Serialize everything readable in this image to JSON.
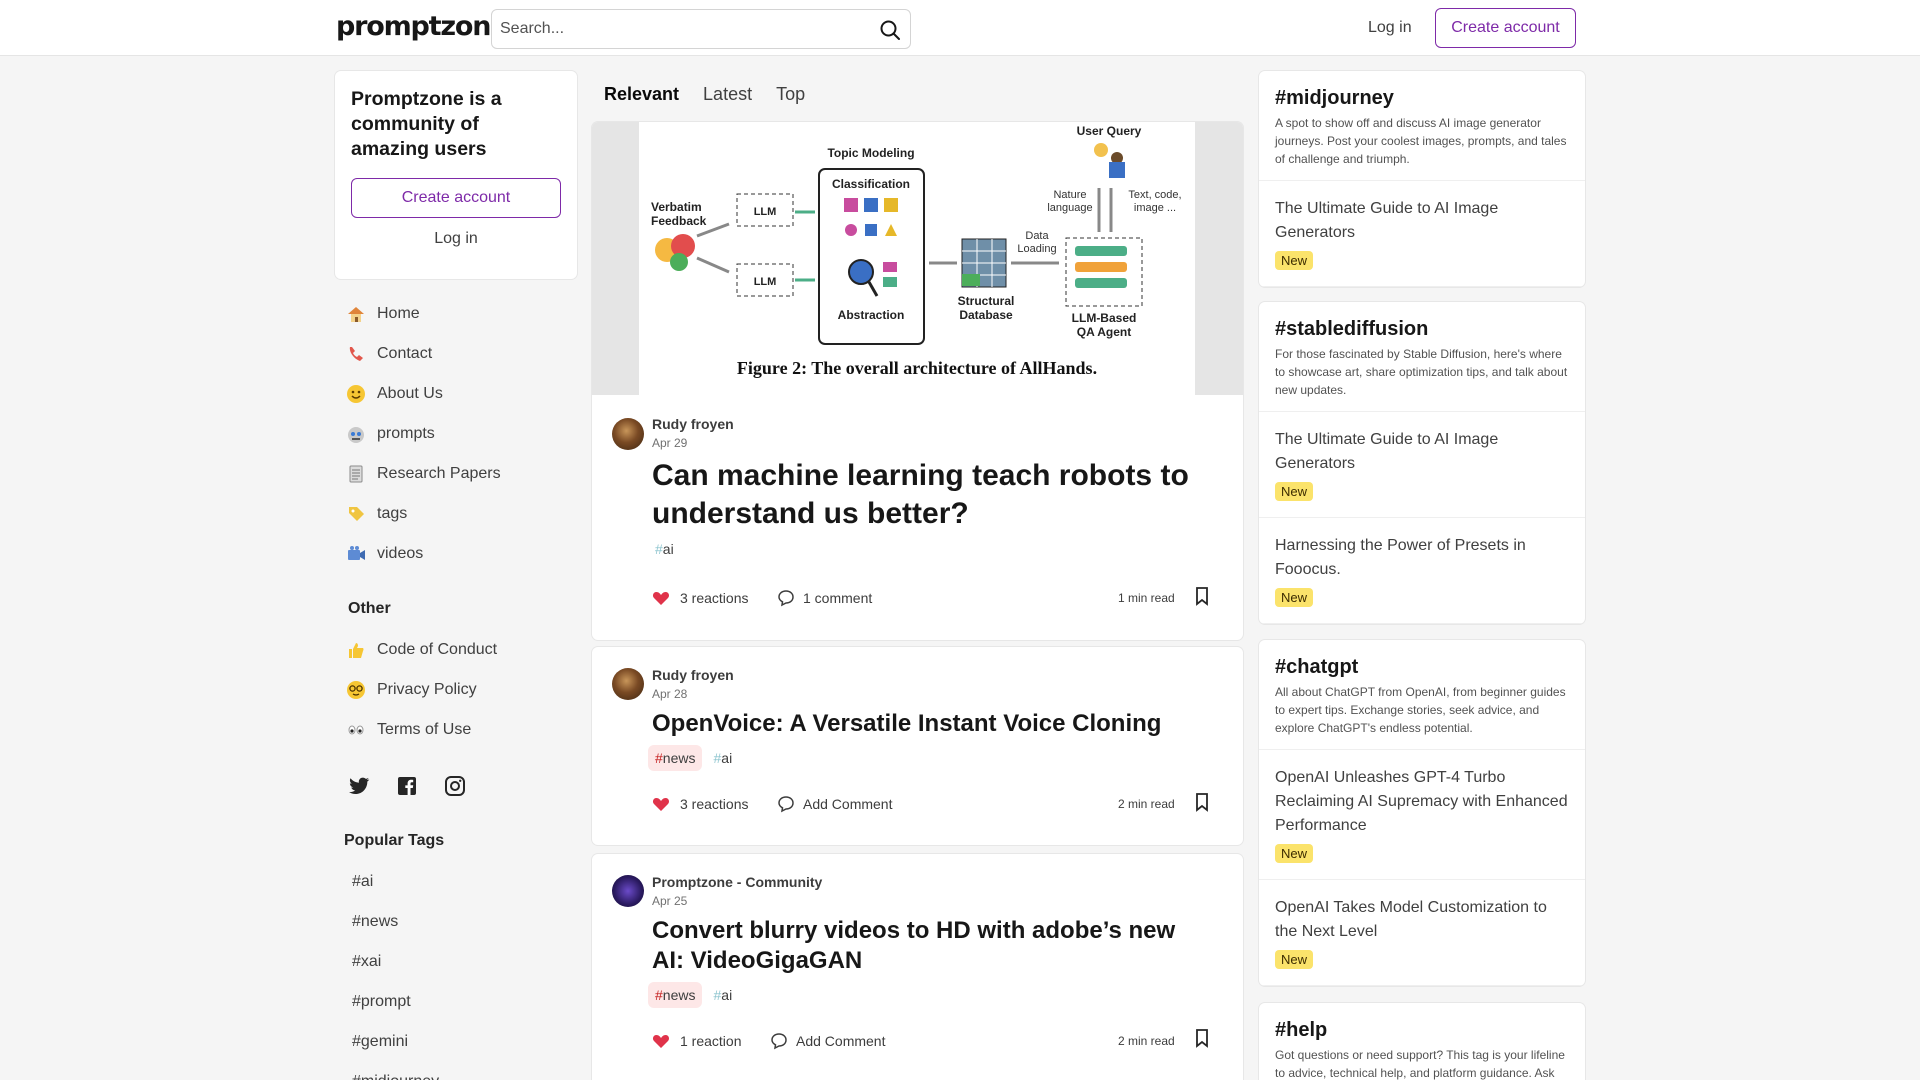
{
  "header": {
    "logo": "promptzone.",
    "search_placeholder": "Search...",
    "login": "Log in",
    "create_account": "Create account"
  },
  "promo": {
    "title": "Promptzone is a community of amazing users",
    "create_account": "Create account",
    "login": "Log in"
  },
  "nav": {
    "items": [
      {
        "label": "Home",
        "icon": "house-icon"
      },
      {
        "label": "Contact",
        "icon": "telephone-icon"
      },
      {
        "label": "About Us",
        "icon": "smiley-icon"
      },
      {
        "label": "prompts",
        "icon": "robot-face-icon"
      },
      {
        "label": "Research Papers",
        "icon": "document-icon"
      },
      {
        "label": "tags",
        "icon": "label-tag-icon"
      },
      {
        "label": "videos",
        "icon": "video-camera-icon"
      }
    ],
    "other_heading": "Other",
    "other_items": [
      {
        "label": "Code of Conduct",
        "icon": "thumbs-up-icon"
      },
      {
        "label": "Privacy Policy",
        "icon": "nerd-face-icon"
      },
      {
        "label": "Terms of Use",
        "icon": "eyes-icon"
      }
    ],
    "social": [
      "twitter-icon",
      "facebook-icon",
      "instagram-icon"
    ]
  },
  "popular_tags": {
    "heading": "Popular Tags",
    "items": [
      "#ai",
      "#news",
      "#xai",
      "#prompt",
      "#gemini",
      "#midjourney"
    ]
  },
  "feed": {
    "tabs": [
      "Relevant",
      "Latest",
      "Top"
    ],
    "active_tab": "Relevant",
    "cover_caption": "Figure 2: The overall architecture of AllHands.",
    "posts": [
      {
        "author": "Rudy froyen",
        "date": "Apr 29",
        "title": "Can machine learning teach robots to understand us better?",
        "tags": [
          {
            "hash": "#",
            "name": "ai"
          }
        ],
        "reactions": "3 reactions",
        "comments": "1 comment",
        "read_time": "1 min read"
      },
      {
        "author": "Rudy froyen",
        "date": "Apr 28",
        "title": "OpenVoice: A Versatile Instant Voice Cloning",
        "tags": [
          {
            "hash": "#",
            "name": "news"
          },
          {
            "hash": "#",
            "name": "ai"
          }
        ],
        "reactions": "3 reactions",
        "comments": "Add Comment",
        "read_time": "2 min read"
      },
      {
        "author": "Promptzone - Community",
        "date": "Apr 25",
        "title": "Convert blurry videos to HD with adobe’s new AI: VideoGigaGAN",
        "tags": [
          {
            "hash": "#",
            "name": "news"
          },
          {
            "hash": "#",
            "name": "ai"
          }
        ],
        "reactions": "1 reaction",
        "comments": "Add Comment",
        "read_time": "2 min read"
      }
    ]
  },
  "diagram": {
    "topic_modeling": "Topic Modeling",
    "classification": "Classification",
    "abstraction": "Abstraction",
    "verbatim": "Verbatim",
    "feedback": "Feedback",
    "llm": "LLM",
    "user_query": "User Query",
    "nature": "Nature",
    "language": "language",
    "text_code": "Text, code,",
    "image": "image ...",
    "data": "Data",
    "loading": "Loading",
    "structural": "Structural",
    "database": "Database",
    "llm_based": "LLM-Based",
    "qa_agent": "QA Agent"
  },
  "right": {
    "boxes": [
      {
        "tag": "#midjourney",
        "desc": "A spot to show off and discuss AI image generator journeys. Post your coolest images, prompts, and tales of challenge and triumph.",
        "items": [
          {
            "title": "The Ultimate Guide to AI Image Generators",
            "badge": "New"
          }
        ]
      },
      {
        "tag": "#stablediffusion",
        "desc": "For those fascinated by Stable Diffusion, here's where to showcase art, share optimization tips, and talk about new updates.",
        "items": [
          {
            "title": "The Ultimate Guide to AI Image Generators",
            "badge": "New"
          },
          {
            "title": "Harnessing the Power of Presets in Fooocus.",
            "badge": "New"
          }
        ]
      },
      {
        "tag": "#chatgpt",
        "desc": "All about ChatGPT from OpenAI, from beginner guides to expert tips. Exchange stories, seek advice, and explore ChatGPT's endless potential.",
        "items": [
          {
            "title": "OpenAI Unleashes GPT-4 Turbo Reclaiming AI Supremacy with Enhanced Performance",
            "badge": "New"
          },
          {
            "title": "OpenAI Takes Model Customization to the Next Level",
            "badge": "New"
          }
        ]
      },
      {
        "tag": "#help",
        "desc": "Got questions or need support? This tag is your lifeline to advice, technical help, and platform guidance. Ask",
        "items": []
      }
    ]
  },
  "colors": {
    "brand": "#7e2aa8",
    "badge": "#fbe36b",
    "news_tag_bg": "#fde7e7"
  }
}
